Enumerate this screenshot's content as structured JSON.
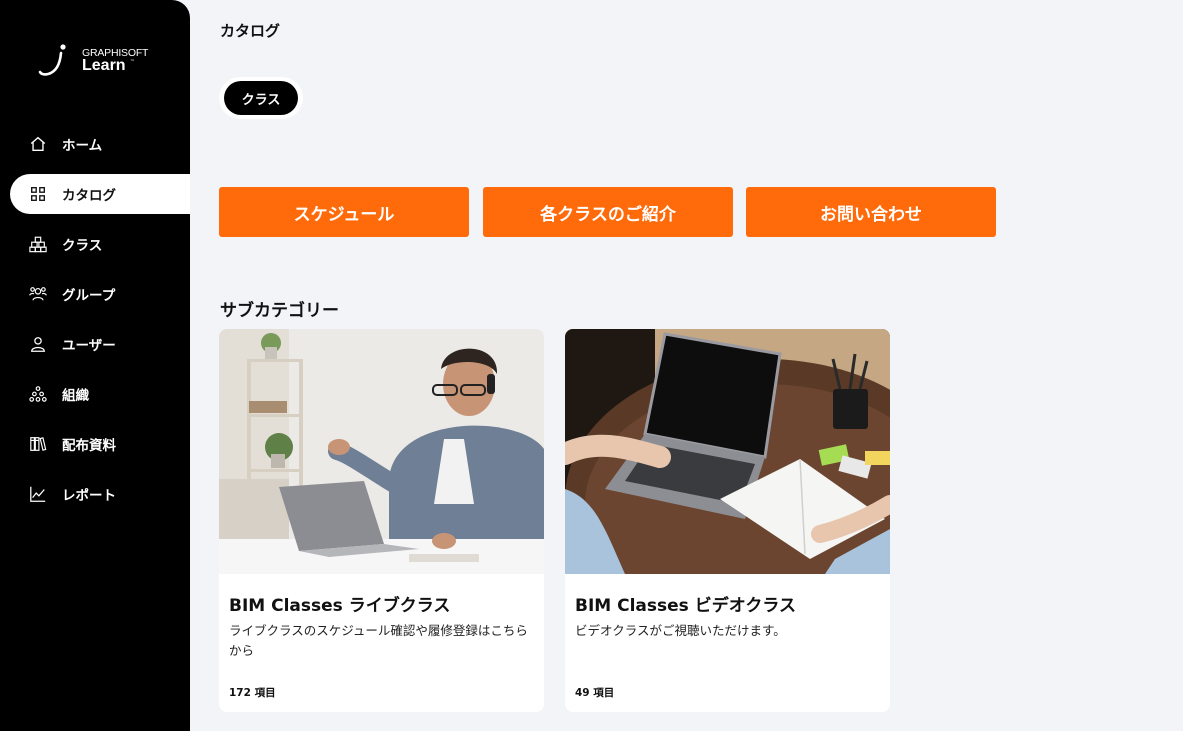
{
  "brand": {
    "small": "GRAPHISOFT",
    "big": "Learn",
    "tm": "™"
  },
  "nav": {
    "items": [
      {
        "label": "ホーム",
        "icon": "home-icon",
        "active": false
      },
      {
        "label": "カタログ",
        "icon": "grid-icon",
        "active": true
      },
      {
        "label": "クラス",
        "icon": "cubes-icon",
        "active": false
      },
      {
        "label": "グループ",
        "icon": "group-icon",
        "active": false
      },
      {
        "label": "ユーザー",
        "icon": "user-icon",
        "active": false
      },
      {
        "label": "組織",
        "icon": "org-chart-icon",
        "active": false
      },
      {
        "label": "配布資料",
        "icon": "books-icon",
        "active": false
      },
      {
        "label": "レポート",
        "icon": "chart-line-icon",
        "active": false
      }
    ]
  },
  "main": {
    "title": "カタログ",
    "filter_pill": "クラス",
    "buttons": [
      "スケジュール",
      "各クラスのご紹介",
      "お問い合わせ"
    ],
    "section_title": "サブカテゴリー",
    "cards": [
      {
        "title": "BIM Classes ライブクラス",
        "description": "ライブクラスのスケジュール確認や履修登録はこちらから",
        "count": "172 項目"
      },
      {
        "title": "BIM Classes ビデオクラス",
        "description": "ビデオクラスがご視聴いただけます。",
        "count": "49 項目"
      }
    ]
  },
  "colors": {
    "sidebar_bg": "#000000",
    "accent": "#ff6a0a",
    "page_bg": "#f3f4f8"
  }
}
